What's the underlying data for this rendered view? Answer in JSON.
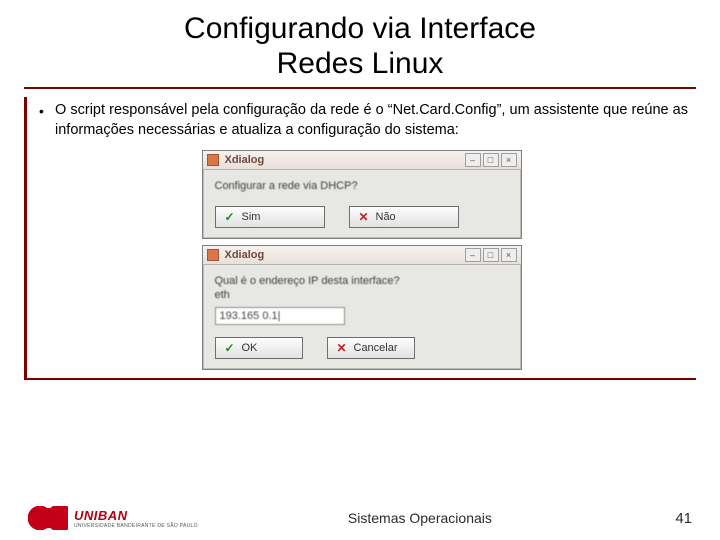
{
  "title_line1": "Configurando via Interface",
  "title_line2": "Redes Linux",
  "bullet": "O script responsável pela configuração da rede é o “Net.Card.Config”, um assistente que reúne as informações necessárias e atualiza a configuração do sistema:",
  "dialog1": {
    "title": "Xdialog",
    "prompt": "Configurar a rede via DHCP?",
    "btn_yes": "Sim",
    "btn_no": "Não"
  },
  "dialog2": {
    "title": "Xdialog",
    "prompt": "Qual é o endereço IP desta interface?",
    "sub": "eth",
    "input": "193.165 0.1|",
    "btn_ok": "OK",
    "btn_cancel": "Cancelar"
  },
  "logo": {
    "name": "UNIBAN",
    "sub": "UNIVERSIDADE BANDEIRANTE DE SÃO PAULO"
  },
  "footer": {
    "center": "Sistemas Operacionais",
    "page": "41"
  }
}
